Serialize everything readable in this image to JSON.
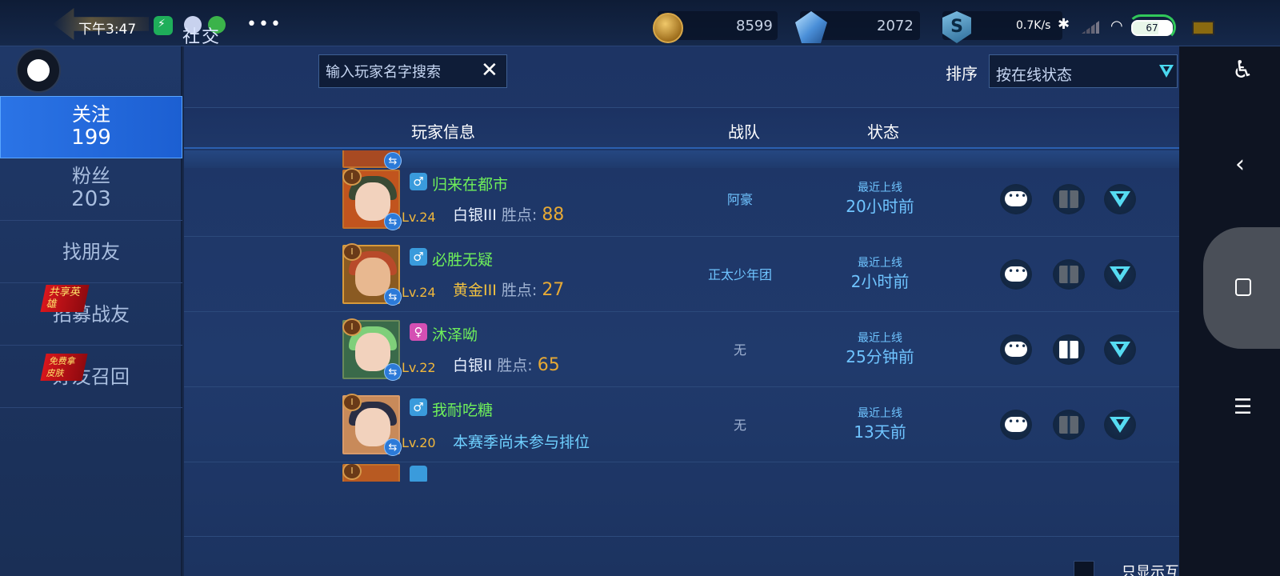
{
  "status_bar": {
    "time": "下午3:47",
    "more": "•••",
    "net_speed": "0.7K/s",
    "battery": "67"
  },
  "header": {
    "title": "社交"
  },
  "currency": {
    "gold": "8599",
    "gems": "2072",
    "s_badge": "S"
  },
  "nav": {
    "follow_label": "关注",
    "follow_count": "199",
    "fans_label": "粉丝",
    "fans_count": "203",
    "find_friends": "找朋友",
    "recruit_tag": "共享英雄",
    "recruit": "招募战友",
    "recall_tag": "免费拿皮肤",
    "recall": "好友召回"
  },
  "search": {
    "placeholder": "输入玩家名字搜索"
  },
  "sort": {
    "label": "排序",
    "value": "按在线状态"
  },
  "table": {
    "headers": {
      "player": "玩家信息",
      "team": "战队",
      "status": "状态"
    },
    "points_label": "胜点:",
    "rows": [
      {
        "name": "归来在都市",
        "gender": "♂",
        "level": "Lv.24",
        "rank": "白银III",
        "points": "88",
        "team": "阿豪",
        "status_label": "最近上线",
        "status_time": "20小时前"
      },
      {
        "name": "必胜无疑",
        "gender": "♂",
        "level": "Lv.24",
        "rank": "黄金III",
        "points": "27",
        "team": "正太少年团",
        "status_label": "最近上线",
        "status_time": "2小时前"
      },
      {
        "name": "沐泽呦",
        "gender": "♀",
        "level": "Lv.22",
        "rank": "白银II",
        "points": "65",
        "team": "无",
        "status_label": "最近上线",
        "status_time": "25分钟前"
      },
      {
        "name": "我耐吃糖",
        "gender": "♂",
        "level": "Lv.20",
        "note": "本赛季尚未参与排位",
        "team": "无",
        "status_label": "最近上线",
        "status_time": "13天前"
      }
    ]
  },
  "footer": {
    "mutual_only": "只显示互相关注"
  },
  "colors": {
    "accent": "#2b74e6",
    "name_green": "#6ff05a",
    "status_blue": "#6fc4ff",
    "points_gold": "#e6a935"
  },
  "icons": {
    "clear": "close-icon",
    "sort": "chevron-down-icon",
    "chat": "chat-bubble-icon",
    "gift": "gift-icon",
    "more": "chevron-down-icon",
    "accessibility": "accessibility-icon",
    "back": "back-icon",
    "home": "home-icon",
    "menu": "menu-icon"
  }
}
